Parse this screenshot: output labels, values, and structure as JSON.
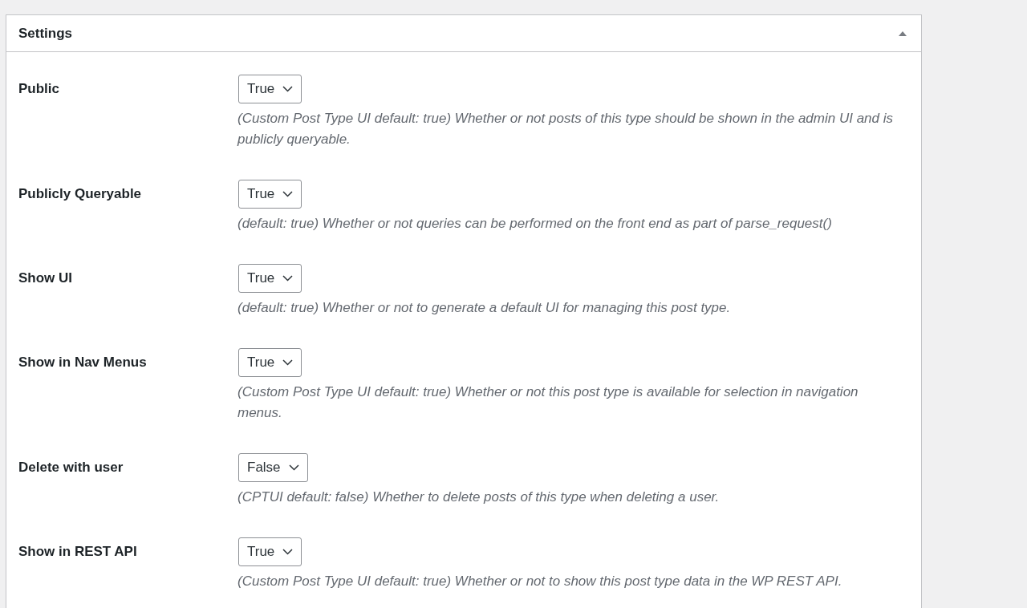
{
  "panel": {
    "title": "Settings",
    "expanded": true
  },
  "rows": [
    {
      "label": "Public",
      "value": "True",
      "description": "(Custom Post Type UI default: true) Whether or not posts of this type should be shown in the admin UI and is publicly queryable."
    },
    {
      "label": "Publicly Queryable",
      "value": "True",
      "description": "(default: true) Whether or not queries can be performed on the front end as part of parse_request()"
    },
    {
      "label": "Show UI",
      "value": "True",
      "description": "(default: true) Whether or not to generate a default UI for managing this post type."
    },
    {
      "label": "Show in Nav Menus",
      "value": "True",
      "description": "(Custom Post Type UI default: true) Whether or not this post type is available for selection in navigation menus."
    },
    {
      "label": "Delete with user",
      "value": "False",
      "description": "(CPTUI default: false) Whether to delete posts of this type when deleting a user."
    },
    {
      "label": "Show in REST API",
      "value": "True",
      "description": "(Custom Post Type UI default: true) Whether or not to show this post type data in the WP REST API."
    }
  ]
}
